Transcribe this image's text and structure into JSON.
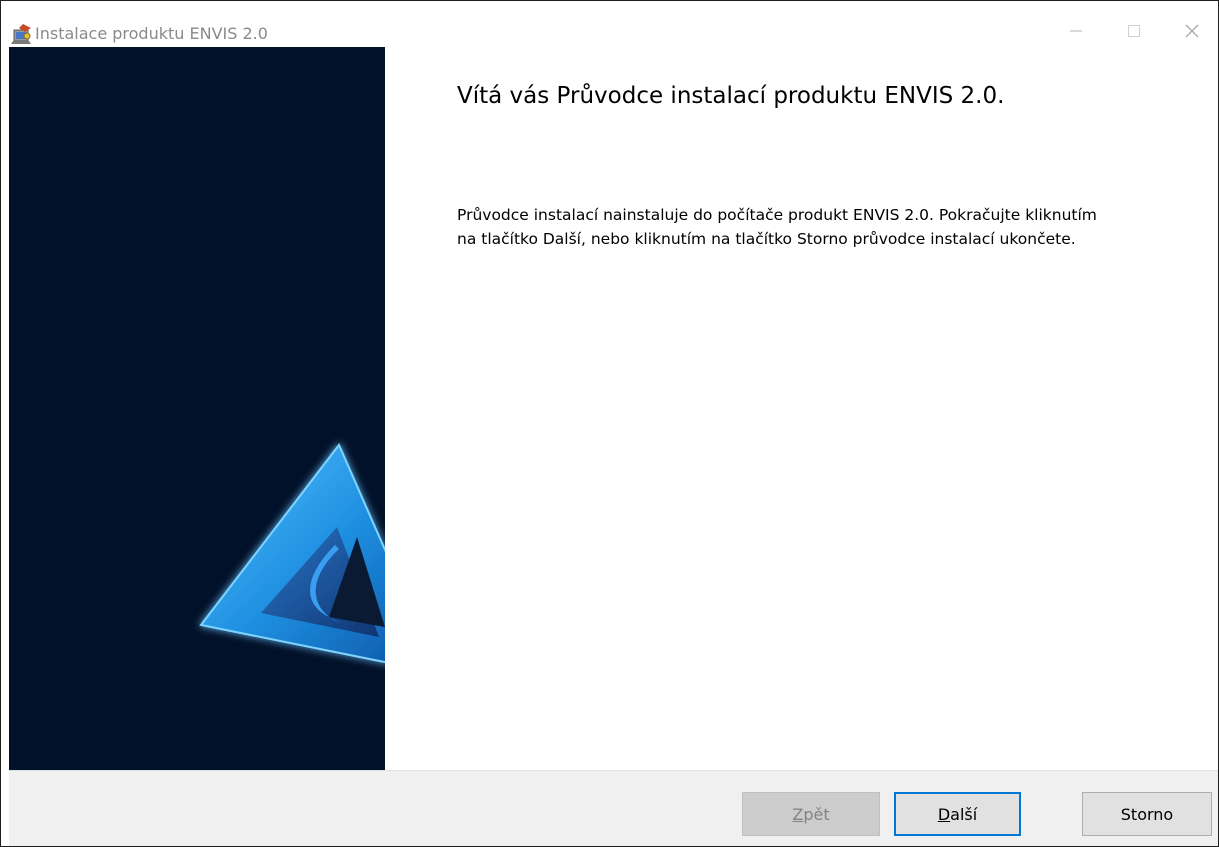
{
  "window": {
    "title": "Instalace produktu ENVIS 2.0"
  },
  "content": {
    "heading": "Vítá vás Průvodce instalací produktu ENVIS 2.0.",
    "body_line1": "Průvodce instalací nainstaluje do počítače produkt ENVIS 2.0. Pokračujte kliknutím",
    "body_line2": "na tlačítko Další, nebo kliknutím na tlačítko Storno průvodce instalací ukončete."
  },
  "footer": {
    "back_accel": "Z",
    "back_rest": "pět",
    "next_accel": "D",
    "next_rest": "alší",
    "cancel_label": "Storno"
  },
  "colors": {
    "sidebar_bg": "#02112a",
    "logo_blue": "#1e8fe0",
    "accent_focus": "#0078d7"
  },
  "icons": [
    "installer-app-icon",
    "minimize-icon",
    "maximize-icon",
    "close-icon",
    "envis-logo"
  ]
}
